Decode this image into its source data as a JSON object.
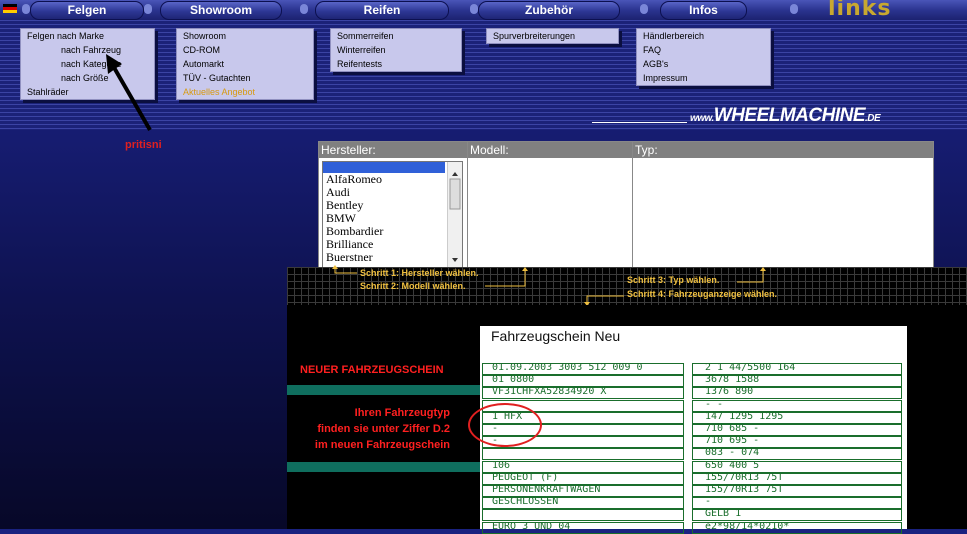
{
  "nav": {
    "items": [
      "Felgen",
      "Showroom",
      "Reifen",
      "Zubehör",
      "Infos"
    ],
    "logo": "links"
  },
  "menus": {
    "felgen": [
      "Felgen nach Marke",
      "nach Fahrzeug",
      "nach Kategorie",
      "nach Größe",
      "Stahlräder"
    ],
    "showroom": [
      "Showroom",
      "CD-ROM",
      "Automarkt",
      "TÜV - Gutachten",
      "Aktuelles Angebot"
    ],
    "reifen": [
      "Sommerreifen",
      "Winterreifen",
      "Reifentests"
    ],
    "zubehoer": [
      "Spurverbreiterungen"
    ],
    "infos": [
      "Händlerbereich",
      "FAQ",
      "AGB's",
      "Impressum"
    ]
  },
  "brand": {
    "main": "WHEELMACHINE",
    "prefix": "www.",
    "suffix": ".DE"
  },
  "annotation": "pritisni",
  "selector": {
    "hersteller_label": "Hersteller:",
    "modell_label": "Modell:",
    "typ_label": "Typ:",
    "hersteller_options": [
      "AlfaRomeo",
      "Audi",
      "Bentley",
      "BMW",
      "Bombardier",
      "Brilliance",
      "Buerstner"
    ]
  },
  "steps": {
    "s1": "Schritt 1: Hersteller wählen.",
    "s2": "Schritt 2: Modell wählen.",
    "s3": "Schritt 3: Typ wählen.",
    "s4": "Schritt 4: Fahrzeuganzeige wählen."
  },
  "info": {
    "neu": "NEUER FAHRZEUGSCHEIN",
    "note1": "Ihren Fahrzeugtyp",
    "note2": "finden sie unter Ziffer D.2",
    "note3": "im neuen Fahrzeugschein"
  },
  "doc": {
    "title": "Fahrzeugschein Neu",
    "left": [
      "01.09.2003  3003 512  009 0",
      "01         0800",
      "VF31CHFXA52834920      X",
      "",
      "1 HFX",
      "-",
      "-",
      "",
      "106",
      "PEUGEOT (F)",
      "PERSONENKRAFTWAGEN",
      "GESCHLOSSEN",
      "",
      "EURO 3 UND 04"
    ],
    "right": [
      "2    1    44/5500    164",
      "3678         1588",
      "1376          890",
      "-       -",
      "147     1295    1295",
      "710      685     -",
      "710      695     -",
      "083      -      074",
      "650      400    5",
      "155/70R13 75T",
      "155/70R13 75T",
      "-",
      "GELB             1",
      "e2*98/14*0210*"
    ]
  }
}
